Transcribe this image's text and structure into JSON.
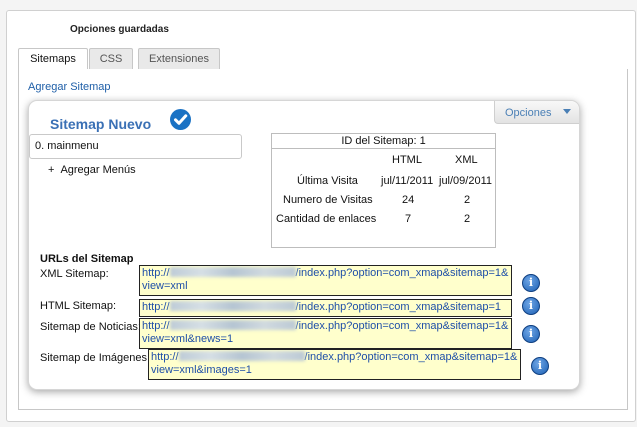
{
  "header": {
    "saved_title": "Opciones guardadas"
  },
  "tabs": [
    {
      "label": "Sitemaps",
      "active": true
    },
    {
      "label": "CSS",
      "active": false
    },
    {
      "label": "Extensiones",
      "active": false
    }
  ],
  "add_sitemap_link": "Agregar Sitemap",
  "card": {
    "title": "Sitemap Nuevo",
    "options_label": "Opciones",
    "menu_item": "0. mainmenu",
    "add_menus": "Agregar Menús",
    "add_menus_symbol": "+",
    "stats": {
      "id_label": "ID del Sitemap: 1",
      "col_html": "HTML",
      "col_xml": "XML",
      "rows": [
        {
          "label": "Última Visita",
          "html": "jul/11/2011",
          "xml": "jul/09/2011"
        },
        {
          "label": "Numero de Visitas",
          "html": "24",
          "xml": "2"
        },
        {
          "label": "Cantidad de enlaces",
          "html": "7",
          "xml": "2"
        }
      ]
    },
    "urls_title": "URLs del Sitemap",
    "urls": [
      {
        "label": "XML Sitemap:",
        "prefix": "http://",
        "line1": "/index.php?option=com_xmap&sitemap=1&",
        "line2": "view=xml"
      },
      {
        "label": "HTML Sitemap:",
        "prefix": "http://",
        "line1": "/index.php?option=com_xmap&sitemap=1",
        "line2": ""
      },
      {
        "label": "Sitemap de Noticias:",
        "prefix": "http://",
        "line1": "/index.php?option=com_xmap&sitemap=1&",
        "line2": "view=xml&news=1"
      },
      {
        "label": "Sitemap de Imágenes:",
        "prefix": "http://",
        "line1": "/index.php?option=com_xmap&sitemap=1&",
        "line2": "view=xml&images=1"
      }
    ],
    "info_symbol": "i"
  },
  "colors": {
    "accent": "#3a70b5",
    "link": "#1f5fa8",
    "url_bg": "#ffffcc",
    "info": "#1b5fb3"
  }
}
